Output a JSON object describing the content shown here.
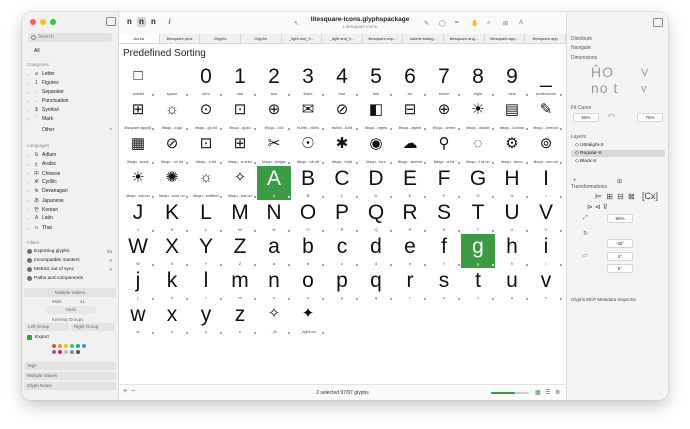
{
  "window": {
    "title": "litesquare-icons.glyphspackage",
    "subtitle": "LiteSquare Icons"
  },
  "sidebar": {
    "search_placeholder": "Search",
    "all_label": "All",
    "categories_header": "Categories",
    "categories": [
      {
        "label": "Letter",
        "glyph": "a"
      },
      {
        "label": "Figures",
        "glyph": "1"
      },
      {
        "label": "Separator",
        "glyph": "·"
      },
      {
        "label": "Punctuation",
        "glyph": "."
      },
      {
        "label": "Symbol",
        "glyph": "$"
      },
      {
        "label": "Mark",
        "glyph": "´"
      }
    ],
    "other_label": "Other",
    "other_count": "7",
    "languages_header": "Languages",
    "languages": [
      {
        "label": "Arabic",
        "glyph": "ع"
      },
      {
        "label": "Chinese",
        "glyph": "中"
      },
      {
        "label": "Cyrillic",
        "glyph": "Ж"
      },
      {
        "label": "Devanagari",
        "glyph": "क"
      },
      {
        "label": "Japanese",
        "glyph": "あ"
      },
      {
        "label": "Korean",
        "glyph": "한"
      },
      {
        "label": "Latin",
        "glyph": "A"
      },
      {
        "label": "Thai",
        "glyph": "ก"
      }
    ],
    "language_first": "Adlam",
    "filters_header": "Filters",
    "filters": [
      {
        "label": "Exporting glyphs",
        "count": "95"
      },
      {
        "label": "Incompatible masters",
        "count": "0"
      },
      {
        "label": "Metrics out of sync",
        "count": "0"
      },
      {
        "label": "Paths and components",
        "count": ""
      }
    ],
    "multiple_values": "Multiple Values",
    "multi_label": "Multi",
    "multi_value": "41",
    "multi_field": "Multi",
    "kerning_groups": "Kerning Groups",
    "left_group": "Left Group",
    "right_group": "Right Group",
    "export_label": "Export",
    "tags_label": "Tags",
    "multiple_values_2": "Multiple Values",
    "glyph_notes": "Glyph Notes",
    "swatch_colors": [
      "#e84c3d",
      "#f39c12",
      "#f1c40f",
      "#2ecc71",
      "#27ae60",
      "#3498db",
      "#9b59b6",
      "#e91e63",
      "#bdc3c7",
      "#7f8c8d",
      "#555555"
    ]
  },
  "toolbar": {
    "btn_n1": "n",
    "btn_n2": "n",
    "btn_n3": "n",
    "btn_i": "i"
  },
  "tabs": [
    "Aurea",
    "litesquare.plus",
    "Glyphs",
    "Glyphs",
    "_light-snr|_li...",
    "_light-snr|_li...",
    "litesquare.exp...",
    "bubble.backg...",
    "litesquare.ang...",
    "litesquare.app...",
    "litesquare.app"
  ],
  "content": {
    "section_title": "Predefined Sorting",
    "cells": [
      {
        "g": "□",
        "n": ".notdef",
        "icon": true
      },
      {
        "g": "",
        "n": "space"
      },
      {
        "g": "0",
        "n": "zero"
      },
      {
        "g": "1",
        "n": "one"
      },
      {
        "g": "2",
        "n": "two"
      },
      {
        "g": "3",
        "n": "three"
      },
      {
        "g": "4",
        "n": "four"
      },
      {
        "g": "5",
        "n": "five"
      },
      {
        "g": "6",
        "n": "six"
      },
      {
        "g": "7",
        "n": "seven"
      },
      {
        "g": "8",
        "n": "eight"
      },
      {
        "g": "9",
        "n": "nine"
      },
      {
        "g": "_",
        "n": "underscore"
      },
      {
        "g": "⊞",
        "n": "litsquare.app@",
        "icon": true
      },
      {
        "g": "☼",
        "n": "litsqu...logo",
        "icon": true
      },
      {
        "g": "⊙",
        "n": "litsqu...go.lid",
        "icon": true
      },
      {
        "g": "⊡",
        "n": "litsqu...gi.lid",
        "icon": true
      },
      {
        "g": "⊕",
        "n": "litsqu...l.lid",
        "icon": true
      },
      {
        "g": "✉",
        "n": "bubbl...rkles",
        "icon": true
      },
      {
        "g": "⊘",
        "n": "bubbl...d.lid",
        "icon": true
      },
      {
        "g": "◧",
        "n": "litsqu...ngles",
        "icon": true
      },
      {
        "g": "⊟",
        "n": "litsqu...agent",
        "icon": true
      },
      {
        "g": "⊕",
        "n": "litsqu...umen",
        "icon": true
      },
      {
        "g": "☀",
        "n": "litsqu...wlude",
        "icon": true
      },
      {
        "g": "▤",
        "n": "litsqu...k.book",
        "icon": true
      },
      {
        "g": "✎",
        "n": "litsqu...wrench",
        "icon": true
      },
      {
        "g": "▦",
        "n": "litsqu...book",
        "icon": true
      },
      {
        "g": "⊘",
        "n": "litsqu...ch.lid",
        "icon": true
      },
      {
        "g": "⊡",
        "n": "litsqu...u.lid",
        "icon": true
      },
      {
        "g": "⊞",
        "n": "litsqu...a.shld",
        "icon": true
      },
      {
        "g": "✂",
        "n": "litsqu...magic",
        "icon": true
      },
      {
        "g": "☉",
        "n": "litsqu...ub.cfl",
        "icon": true
      },
      {
        "g": "✱",
        "n": "litsqu...bulb",
        "icon": true
      },
      {
        "g": "◉",
        "n": "litsqu...tors",
        "icon": true
      },
      {
        "g": "☁",
        "n": "litsqu...ascent",
        "icon": true
      },
      {
        "g": "⚲",
        "n": "litsqu...w.lid",
        "icon": true
      },
      {
        "g": "◌",
        "n": "litsqu...t.id.on",
        "icon": true
      },
      {
        "g": "⚙",
        "n": "litsqu...deco",
        "icon": true
      },
      {
        "g": "⊚",
        "n": "litsqu...eco.on",
        "icon": true
      },
      {
        "g": "☀",
        "n": "litsqu...edcon",
        "icon": true
      },
      {
        "g": "✺",
        "n": "litsqu...icon.on",
        "icon": true
      },
      {
        "g": "☼",
        "n": "litsqu...entitled",
        "icon": true
      },
      {
        "g": "✧",
        "n": "litsqu...ied.on",
        "icon": true
      },
      {
        "g": "A",
        "n": "A",
        "sel": true
      },
      {
        "g": "B",
        "n": "B"
      },
      {
        "g": "C",
        "n": "C"
      },
      {
        "g": "D",
        "n": "D"
      },
      {
        "g": "E",
        "n": "E"
      },
      {
        "g": "F",
        "n": "F"
      },
      {
        "g": "G",
        "n": "G"
      },
      {
        "g": "H",
        "n": "H"
      },
      {
        "g": "I",
        "n": "I"
      },
      {
        "g": "J",
        "n": "J"
      },
      {
        "g": "K",
        "n": "K"
      },
      {
        "g": "L",
        "n": "L"
      },
      {
        "g": "M",
        "n": "M"
      },
      {
        "g": "N",
        "n": "N"
      },
      {
        "g": "O",
        "n": "O"
      },
      {
        "g": "P",
        "n": "P"
      },
      {
        "g": "Q",
        "n": "Q"
      },
      {
        "g": "R",
        "n": "R"
      },
      {
        "g": "S",
        "n": "S"
      },
      {
        "g": "T",
        "n": "T"
      },
      {
        "g": "U",
        "n": "U"
      },
      {
        "g": "V",
        "n": "V"
      },
      {
        "g": "W",
        "n": "W"
      },
      {
        "g": "X",
        "n": "X"
      },
      {
        "g": "Y",
        "n": "Y"
      },
      {
        "g": "Z",
        "n": "Z"
      },
      {
        "g": "a",
        "n": "a"
      },
      {
        "g": "b",
        "n": "b"
      },
      {
        "g": "c",
        "n": "c"
      },
      {
        "g": "d",
        "n": "d"
      },
      {
        "g": "e",
        "n": "e"
      },
      {
        "g": "f",
        "n": "f"
      },
      {
        "g": "g",
        "n": "g",
        "sel": true
      },
      {
        "g": "h",
        "n": "h"
      },
      {
        "g": "i",
        "n": "i"
      },
      {
        "g": "j",
        "n": "j"
      },
      {
        "g": "k",
        "n": "k"
      },
      {
        "g": "l",
        "n": "l"
      },
      {
        "g": "m",
        "n": "m"
      },
      {
        "g": "n",
        "n": "n"
      },
      {
        "g": "o",
        "n": "o"
      },
      {
        "g": "p",
        "n": "p"
      },
      {
        "g": "q",
        "n": "q"
      },
      {
        "g": "r",
        "n": "r"
      },
      {
        "g": "s",
        "n": "s"
      },
      {
        "g": "t",
        "n": "t"
      },
      {
        "g": "u",
        "n": "u"
      },
      {
        "g": "v",
        "n": "v"
      },
      {
        "g": "w",
        "n": "w"
      },
      {
        "g": "x",
        "n": "x"
      },
      {
        "g": "y",
        "n": "y"
      },
      {
        "g": "z",
        "n": "z"
      },
      {
        "g": "✧",
        "n": "_lit",
        "icon": true
      },
      {
        "g": "✦",
        "n": "_light-on",
        "icon": true
      }
    ],
    "status": "2 selected 97/97 glyphs"
  },
  "inspector": {
    "distribute": "Distribute",
    "navigate": "Navigate",
    "dimensions": "Dimensions",
    "fit_curve": "Fit Curve",
    "fit_left": "56%",
    "fit_right": "75%",
    "layers_header": "Layers",
    "layers": [
      "Ultralight-S",
      "Regular-S",
      "Black-S"
    ],
    "transformations": "Transformations",
    "scale_value": "80%",
    "rotate_value": "-45°",
    "skew_value": "5°",
    "other_value": "5°",
    "metadata": "Glyphs MCP Metadata Inspector"
  },
  "colors": {
    "selection": "#3d9b46",
    "sidebar_bg": "#f1f1f1"
  }
}
